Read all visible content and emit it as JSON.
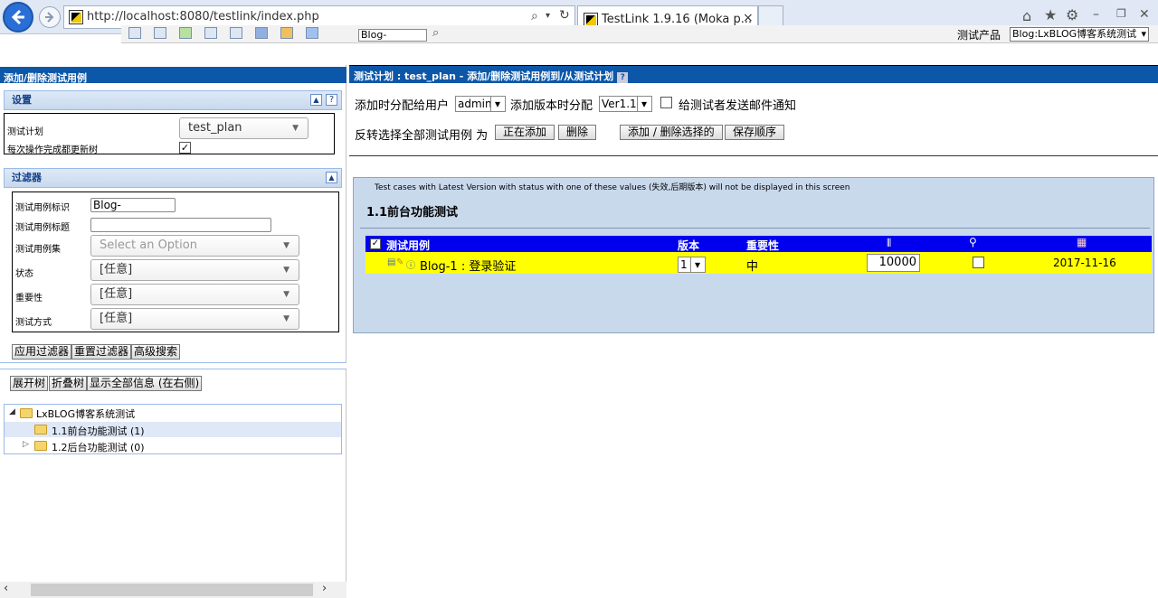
{
  "browser": {
    "url": "http://localhost:8080/testlink/index.php",
    "tab_title": "TestLink 1.9.16 (Moka p...",
    "tab_close": "×"
  },
  "topbar": {
    "search_value": "Blog-",
    "product_label": "测试产品",
    "product_value": "Blog:LxBLOG博客系统测试"
  },
  "left": {
    "title": "添加/删除测试用例",
    "settings": {
      "title": "设置",
      "plan_label": "测试计划",
      "plan_value": "test_plan",
      "update_tree_label": "每次操作完成都更新树",
      "update_tree_checked": "✓"
    },
    "filters": {
      "title": "过滤器",
      "tc_id_label": "测试用例标识",
      "tc_id_value": "Blog-",
      "tc_title_label": "测试用例标题",
      "tc_title_value": "",
      "suite_label": "测试用例集",
      "suite_placeholder": "Select an Option",
      "status_label": "状态",
      "status_value": "[任意]",
      "importance_label": "重要性",
      "importance_value": "[任意]",
      "exec_type_label": "测试方式",
      "exec_type_value": "[任意]",
      "apply_btn": "应用过滤器",
      "reset_btn": "重置过滤器",
      "advanced_btn": "高级搜索"
    },
    "tree_buttons": {
      "expand": "展开树",
      "collapse": "折叠树",
      "show_all": "显示全部信息 (在右侧)"
    },
    "tree": {
      "root": "LxBLOG博客系统测试",
      "nodes": [
        "1.1前台功能测试 (1)",
        "1.2后台功能测试 (0)"
      ]
    }
  },
  "right": {
    "title": "测试计划 : test_plan - 添加/删除测试用例到/从测试计划",
    "assign_label": "添加时分配给用户",
    "assign_value": "admin",
    "version_label": "添加版本时分配",
    "version_value": "Ver1.1",
    "email_label": "给测试者发送邮件通知",
    "toggle_label": "反转选择全部测试用例 为",
    "btn_adding": "正在添加",
    "btn_delete": "删除",
    "btn_add_remove": "添加 / 删除选择的",
    "btn_save_order": "保存顺序",
    "notice": "Test cases with Latest Version with status with one of these values (失效,后期版本) will not be displayed in this screen",
    "suite_title": "1.1前台功能测试",
    "table": {
      "headers": {
        "tc": "测试用例",
        "version": "版本",
        "importance": "重要性"
      },
      "row": {
        "name": "Blog-1 : 登录验证",
        "version": "1",
        "importance": "中",
        "order": "10000",
        "date": "2017-11-16"
      }
    }
  },
  "colors": {
    "header_blue": "#0d57a8",
    "table_header": "#0000ee",
    "row_highlight": "#ffff00",
    "panel_bg": "#c9d9ec"
  }
}
